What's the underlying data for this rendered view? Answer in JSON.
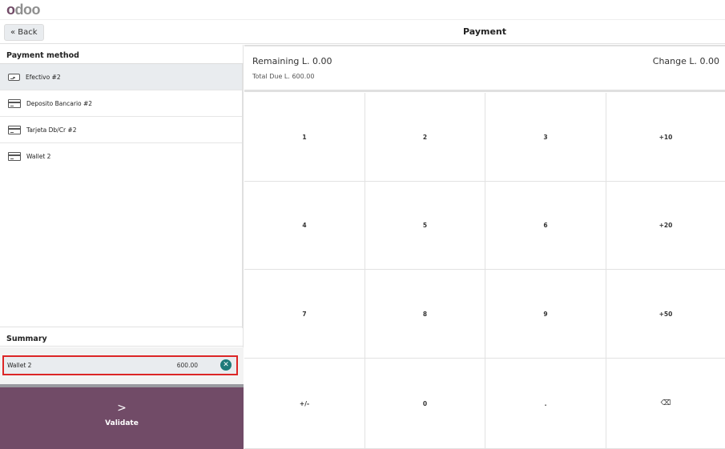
{
  "app": {
    "logo_parts": [
      "o",
      "d",
      "o",
      "o"
    ]
  },
  "header": {
    "back_label": "« Back",
    "title": "Payment"
  },
  "payment_methods": {
    "title": "Payment method",
    "items": [
      {
        "label": "Efectivo #2",
        "icon": "cash-icon",
        "active": true
      },
      {
        "label": "Deposito Bancario #2",
        "icon": "card-icon",
        "active": false
      },
      {
        "label": "Tarjeta Db/Cr #2",
        "icon": "card-icon",
        "active": false
      },
      {
        "label": "Wallet 2",
        "icon": "card-icon",
        "active": false
      }
    ]
  },
  "summary": {
    "title": "Summary",
    "lines": [
      {
        "method": "Wallet 2",
        "amount": "600.00",
        "remove_icon": "close-circle-icon"
      }
    ]
  },
  "validate": {
    "chevron": ">",
    "label": "Validate"
  },
  "status": {
    "remaining": "Remaining L. 0.00",
    "total_due": "Total Due L. 600.00",
    "change": "Change L. 0.00"
  },
  "numpad": {
    "keys": [
      "1",
      "2",
      "3",
      "+10",
      "4",
      "5",
      "6",
      "+20",
      "7",
      "8",
      "9",
      "+50",
      "+/-",
      "0",
      ".",
      "⌫"
    ]
  },
  "colors": {
    "brand": "#714b67",
    "highlight_border": "#dc2626",
    "remove_button": "#1f7a7a"
  }
}
